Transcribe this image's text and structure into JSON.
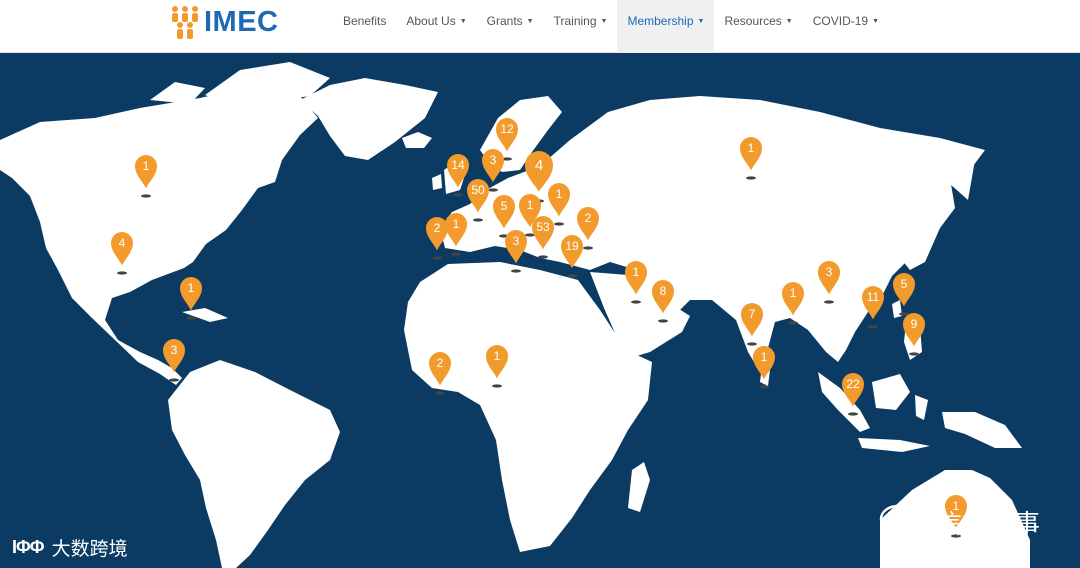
{
  "brand": {
    "name": "IMEC"
  },
  "nav": [
    {
      "label": "Benefits",
      "dropdown": false,
      "active": false
    },
    {
      "label": "About Us",
      "dropdown": true,
      "active": false
    },
    {
      "label": "Grants",
      "dropdown": true,
      "active": false
    },
    {
      "label": "Training",
      "dropdown": true,
      "active": false
    },
    {
      "label": "Membership",
      "dropdown": true,
      "active": true
    },
    {
      "label": "Resources",
      "dropdown": true,
      "active": false
    },
    {
      "label": "COVID-19",
      "dropdown": true,
      "active": false
    }
  ],
  "map": {
    "colors": {
      "ocean": "#0b3b63",
      "land": "#ffffff",
      "pin": "#f39a2c",
      "accent": "#1f69b4"
    },
    "pins": [
      {
        "label": "12",
        "lon": 0,
        "lat": 0
      },
      {
        "label": "1"
      },
      {
        "label": "4"
      },
      {
        "label": "1"
      },
      {
        "label": "3"
      },
      {
        "label": "14"
      },
      {
        "label": "4"
      },
      {
        "label": "50"
      },
      {
        "label": "5"
      },
      {
        "label": "1"
      },
      {
        "label": "1"
      },
      {
        "label": "2"
      },
      {
        "label": "1"
      },
      {
        "label": "2"
      },
      {
        "label": "53"
      },
      {
        "label": "3"
      },
      {
        "label": "19"
      },
      {
        "label": "1"
      },
      {
        "label": "3"
      },
      {
        "label": "1"
      },
      {
        "label": "8"
      },
      {
        "label": "1"
      },
      {
        "label": "3"
      },
      {
        "label": "5"
      },
      {
        "label": "7"
      },
      {
        "label": "11"
      },
      {
        "label": "9"
      },
      {
        "label": "2"
      },
      {
        "label": "1"
      },
      {
        "label": "1"
      },
      {
        "label": "22"
      },
      {
        "label": "1"
      }
    ]
  },
  "watermarks": {
    "left_logo": "IΦΦ",
    "left_text": "大数跨境",
    "right_text": "信德海事"
  }
}
